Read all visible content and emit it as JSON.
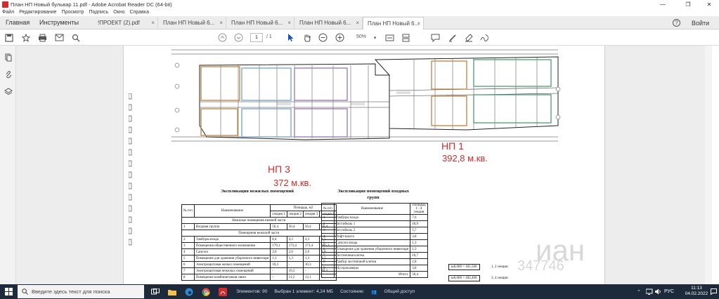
{
  "window": {
    "title": "План НП Новый бульвар 11.pdf - Adobe Acrobat Reader DC (64-bit)",
    "minimize_glyph": "—",
    "restore_glyph": "❐",
    "close_glyph": "✕"
  },
  "menu": [
    "Файл",
    "Редактирование",
    "Просмотр",
    "Подпись",
    "Окно",
    "Справка"
  ],
  "nav_tabs": {
    "home": "Главная",
    "tools": "Инструменты"
  },
  "doc_tabs": [
    {
      "label": "!ПРОЕКТ (2).pdf",
      "close": "×"
    },
    {
      "label": "План НП Новый 6...",
      "close": "×"
    },
    {
      "label": "План НП Новый 6...",
      "close": "×"
    },
    {
      "label": "План НП Новый 6...",
      "close": "×"
    },
    {
      "label": "План НП Новый 6...",
      "close": "×"
    }
  ],
  "topright": {
    "help": "?",
    "signin": "Войти"
  },
  "toolbar": {
    "current_page": "1",
    "page_total": "/ 1",
    "zoom": "50%"
  },
  "annotations": {
    "np3_name": "НП 3",
    "np3_area": "372 м.кв.",
    "np1_name": "НП 1",
    "np1_area": "392,8 м.кв."
  },
  "table_left": {
    "caption": "Экспликация нежилых помещений",
    "header_no": "№ п/п",
    "header_name": "Наименование",
    "header_area": "Площадь, м2",
    "sections": [
      "секция 1",
      "секция 2",
      "секция 3",
      "секция 4"
    ],
    "group1": "Нежилые помещения нижней части",
    "group2": "Помещения нежилой части",
    "rows": [
      {
        "no": "1",
        "name": "Входная группа",
        "v": [
          "56,4",
          "56,4",
          "56,4",
          "56,4"
        ]
      },
      {
        "no": "2",
        "name": "Тамбуры входа",
        "v": [
          "8,4",
          "4,3",
          "4,3",
          "4,3"
        ]
      },
      {
        "no": "3",
        "name": "Помещения общественного назначения",
        "v": [
          "179,1",
          "173,4",
          "173,4",
          "205,2"
        ]
      },
      {
        "no": "4",
        "name": "Санузел",
        "v": [
          "2,0",
          "2,0",
          "2,0",
          "2,0"
        ]
      },
      {
        "no": "5",
        "name": "Помещение для хранения уборочного инвентаря",
        "v": [
          "1,3",
          "1,3",
          "1,3",
          "1,3"
        ]
      },
      {
        "no": "6",
        "name": "Электрощитовая жилых помещений",
        "v": [
          "10,3",
          "-",
          "10,3",
          "-"
        ]
      },
      {
        "no": "7",
        "name": "Электрощитовая нежилых помещений",
        "v": [
          "-",
          "10,3",
          "-",
          "10,3"
        ]
      },
      {
        "no": "8",
        "name": "Помещение комбинатчиков связи",
        "v": [
          "-",
          "11,2",
          "12,1",
          "-"
        ]
      }
    ]
  },
  "table_right": {
    "caption_line1": "Экспликация помещений входных",
    "caption_line2": "групп",
    "header_no": "№ п/п",
    "header_name": "Наименование",
    "header_area": "Площадь 1 - 4 секции",
    "rows": [
      {
        "no": "1",
        "name": "Тамбуры входа",
        "v": "7,6"
      },
      {
        "no": "2",
        "name": "Вестибюль 1",
        "v": "18,9"
      },
      {
        "no": "3",
        "name": "Вестибюль 2",
        "v": "5,7"
      },
      {
        "no": "4",
        "name": "Лифт-шахта",
        "v": "3,8"
      },
      {
        "no": "5",
        "name": "Санузел входа",
        "v": "1,3"
      },
      {
        "no": "6",
        "name": "Помещение для хранения уборочного инвентаря",
        "v": "1,3"
      },
      {
        "no": "7",
        "name": "Лестничная клетка",
        "v": "10,7"
      },
      {
        "no": "8",
        "name": "Тамбур лестничной клетки",
        "v": "2,8"
      },
      {
        "no": "9",
        "name": "Мусорокамеры",
        "v": "3,8"
      }
    ],
    "total_label": "Итого:",
    "total_value": "50,4"
  },
  "formulas": [
    {
      "box": "ю0,000 = 181,500",
      "note": "1, 2 секции"
    },
    {
      "box": "ю0,000 = 182,400",
      "note": "3, 4 секции"
    }
  ],
  "watermark": {
    "line1": "иан",
    "line2": "347746"
  },
  "taskbar": {
    "search_placeholder": "Введите здесь текст для поиска",
    "items_count": "Элементов: 90",
    "selected": "Выбран 1 элемент: 4,24 МБ",
    "state": "Состояние:",
    "shared": "Общий доступ",
    "lang": "РУС",
    "time": "11:13",
    "date": "04.02.2022"
  },
  "colors": {
    "accent_red": "#d52b2b",
    "tab_bg": "#ececec",
    "taskbar_bg": "#1c2a3c"
  }
}
